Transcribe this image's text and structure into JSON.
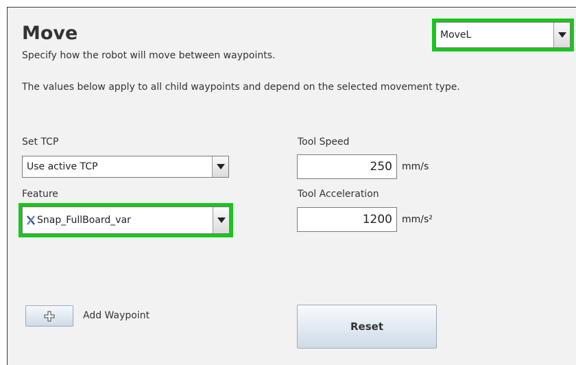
{
  "move": {
    "title": "Move",
    "subtitle": "Specify how the robot will move between waypoints.",
    "description": "The values below apply to all child waypoints and depend on the selected movement type.",
    "move_type": "MoveL"
  },
  "tcp": {
    "label": "Set TCP",
    "value": "Use active TCP"
  },
  "feature": {
    "label": "Feature",
    "value": "Snap_FullBoard_var",
    "icon": "variable-x-icon"
  },
  "tool_speed": {
    "label": "Tool Speed",
    "value": "250",
    "unit": "mm/s"
  },
  "tool_acceleration": {
    "label": "Tool Acceleration",
    "value": "1200",
    "unit": "mm/s²"
  },
  "actions": {
    "add_waypoint": "Add Waypoint",
    "reset": "Reset"
  },
  "colors": {
    "highlight": "#19c51e",
    "panel_bg": "#f2f2f2",
    "button_top": "#f6f9fc",
    "button_bottom": "#cfdbe7"
  }
}
